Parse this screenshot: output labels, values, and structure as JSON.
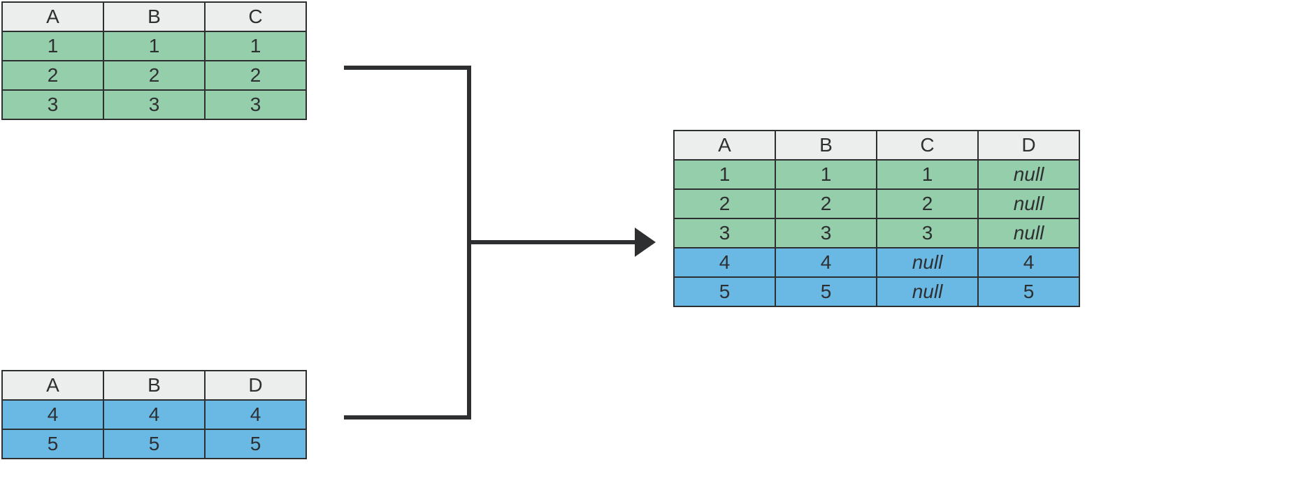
{
  "colors": {
    "header_bg": "#eceeed",
    "green": "#95ceab",
    "blue": "#6ab9e5",
    "border": "#2d2f31"
  },
  "table1": {
    "headers": [
      "A",
      "B",
      "C"
    ],
    "rows": [
      {
        "cells": [
          "1",
          "1",
          "1"
        ],
        "color": "green"
      },
      {
        "cells": [
          "2",
          "2",
          "2"
        ],
        "color": "green"
      },
      {
        "cells": [
          "3",
          "3",
          "3"
        ],
        "color": "green"
      }
    ]
  },
  "table2": {
    "headers": [
      "A",
      "B",
      "D"
    ],
    "rows": [
      {
        "cells": [
          "4",
          "4",
          "4"
        ],
        "color": "blue"
      },
      {
        "cells": [
          "5",
          "5",
          "5"
        ],
        "color": "blue"
      }
    ]
  },
  "table3": {
    "headers": [
      "A",
      "B",
      "C",
      "D"
    ],
    "rows": [
      {
        "cells": [
          "1",
          "1",
          "1",
          "null"
        ],
        "color": "green"
      },
      {
        "cells": [
          "2",
          "2",
          "2",
          "null"
        ],
        "color": "green"
      },
      {
        "cells": [
          "3",
          "3",
          "3",
          "null"
        ],
        "color": "green"
      },
      {
        "cells": [
          "4",
          "4",
          "null",
          "4"
        ],
        "color": "blue"
      },
      {
        "cells": [
          "5",
          "5",
          "null",
          "5"
        ],
        "color": "blue"
      }
    ]
  }
}
